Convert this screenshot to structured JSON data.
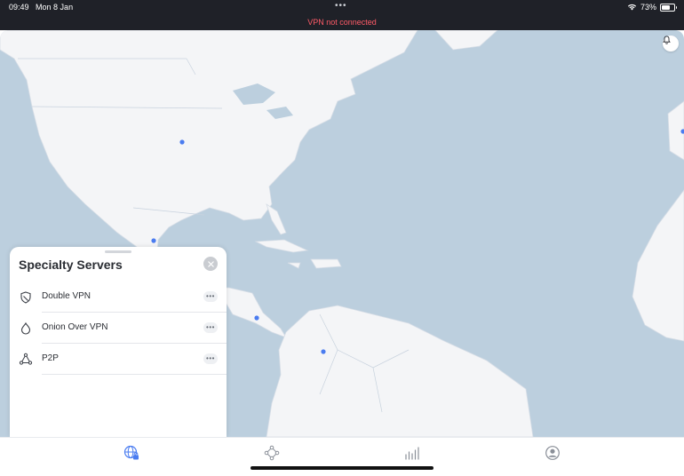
{
  "status_bar": {
    "time": "09:49",
    "date": "Mon 8 Jan",
    "center_dots": "•••",
    "vpn_status": "VPN not connected",
    "battery_percent": "73%",
    "battery_level": 0.73
  },
  "panel": {
    "title": "Specialty Servers",
    "items": [
      {
        "label": "Double VPN",
        "icon": "shield-icon",
        "more": "•••"
      },
      {
        "label": "Onion Over VPN",
        "icon": "onion-icon",
        "more": "•••"
      },
      {
        "label": "P2P",
        "icon": "p2p-icon",
        "more": "•••"
      }
    ]
  },
  "tabs": [
    {
      "name": "globe-lock-icon",
      "active": true
    },
    {
      "name": "meshnet-icon",
      "active": false
    },
    {
      "name": "stats-icon",
      "active": false
    },
    {
      "name": "profile-icon",
      "active": false
    }
  ],
  "colors": {
    "accent": "#4a7cf0",
    "alert": "#ff5b67",
    "ocean": "#bccfde",
    "land": "#f4f5f7"
  }
}
